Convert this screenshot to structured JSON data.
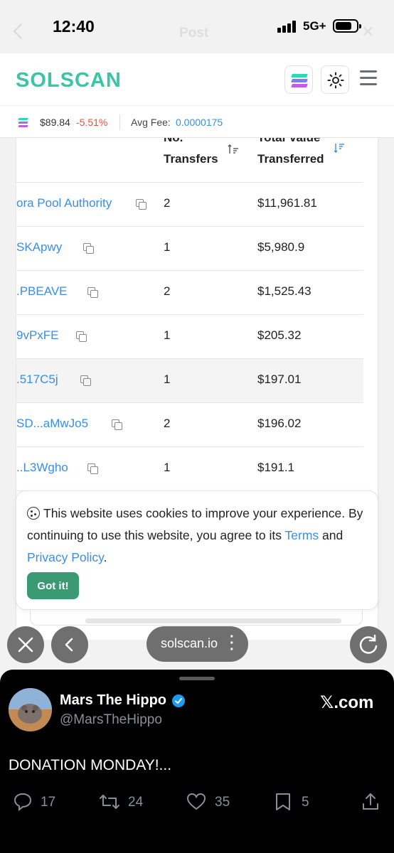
{
  "status_bar": {
    "time": "12:40",
    "network": "5G+",
    "battery_level": 0.8,
    "ghost_title": "Post"
  },
  "header": {
    "logo": "SOLSCAN",
    "brand_color": "#3cc5a4"
  },
  "price_bar": {
    "sol_price": "$89.84",
    "sol_change": "-5.51%",
    "fee_label": "Avg Fee:",
    "fee_value": "0.0000175"
  },
  "table": {
    "col_transfers": "No. Transfers",
    "col_value": "Total Value Transferred",
    "rows": [
      {
        "address": "ora Pool Authority",
        "transfers": "2",
        "value": "$11,961.81"
      },
      {
        "address": "SKApwy",
        "transfers": "1",
        "value": "$5,980.9"
      },
      {
        "address": ".PBEAVE",
        "transfers": "2",
        "value": "$1,525.43"
      },
      {
        "address": "9vPxFE",
        "transfers": "1",
        "value": "$205.32"
      },
      {
        "address": ".517C5j",
        "transfers": "1",
        "value": "$197.01"
      },
      {
        "address": "SD...aMwJo5",
        "transfers": "2",
        "value": "$196.02"
      },
      {
        "address": "..L3Wgho",
        "transfers": "1",
        "value": "$191.1"
      }
    ]
  },
  "cookie_banner": {
    "text_1": "This website uses cookies to improve your experience. By continuing to use this website, you agree to its ",
    "terms_link": "Terms",
    "text_2": " and ",
    "privacy_link": "Privacy Policy",
    "text_3": ".",
    "button": "Got it!"
  },
  "browser": {
    "url": "solscan.io",
    "close_icon": "close-icon",
    "back_icon": "chevron-left-icon",
    "reload_icon": "reload-icon"
  },
  "x_post": {
    "author": "Mars The Hippo",
    "handle": "@MarsTheHippo",
    "site": "𝕏.com",
    "text": "DONATION MONDAY!...",
    "replies": "17",
    "reposts": "24",
    "likes": "35",
    "bookmarks": "5"
  }
}
